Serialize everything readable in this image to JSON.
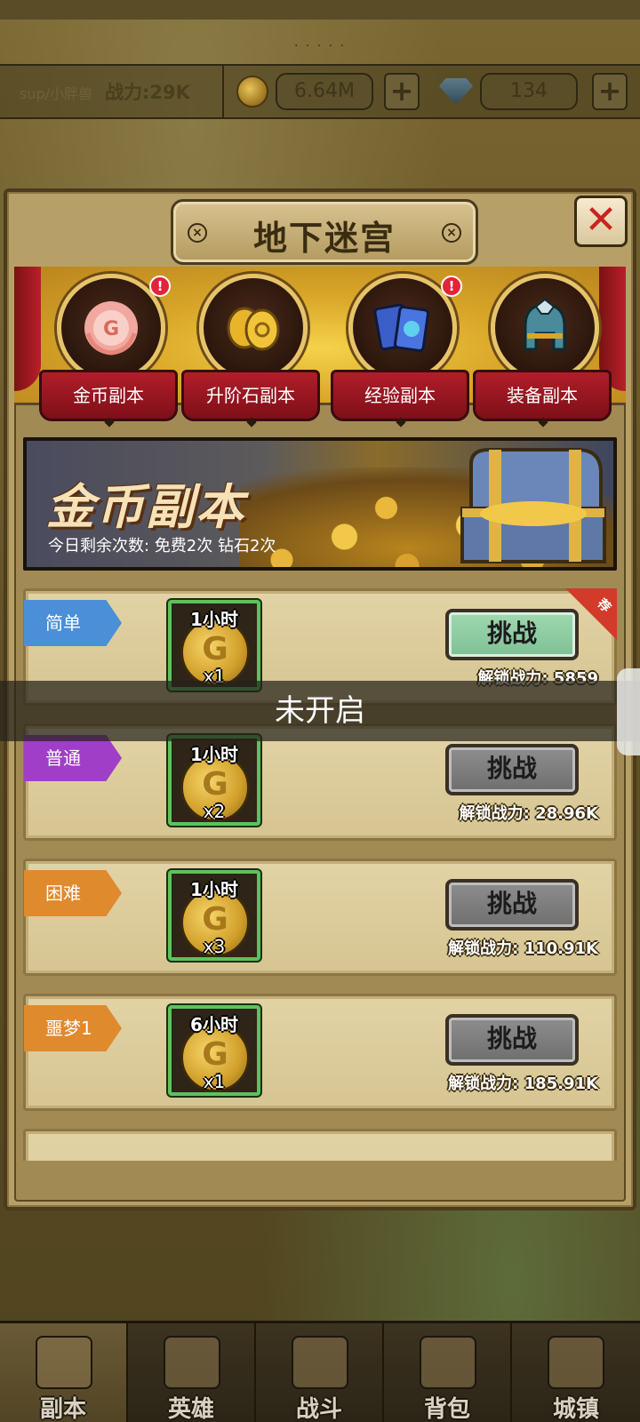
{
  "resource_bar": {
    "player_name": "sup/小胖兽",
    "power_text": "战力:29K",
    "gold_amount": "6.64M",
    "gem_amount": "134",
    "plus_label": "+"
  },
  "top_dots": ". . . . .",
  "dialog": {
    "title": "地下迷宫",
    "close_label": "✕",
    "screw_glyph": "×"
  },
  "categories": [
    {
      "label": "金币副本",
      "icon": "gold-laurel-emblem-icon",
      "alert": "!"
    },
    {
      "label": "升阶石副本",
      "icon": "upgrade-stone-icon",
      "alert": ""
    },
    {
      "label": "经验副本",
      "icon": "experience-cards-icon",
      "alert": "!"
    },
    {
      "label": "装备副本",
      "icon": "equipment-helmet-icon",
      "alert": ""
    }
  ],
  "banner": {
    "title": "金币副本",
    "subtitle": "今日剩余次数:  免费2次  钻石2次"
  },
  "stages": [
    {
      "tag": "简单",
      "tag_color": "#4a8fd8",
      "time": "1小时",
      "qty": "x1",
      "button": "挑战",
      "unlock": "解锁战力:  5859",
      "recommended": "荐"
    },
    {
      "tag": "普通",
      "tag_color": "#a03ec8",
      "time": "1小时",
      "qty": "x2",
      "button": "挑战",
      "unlock": "解锁战力:  28.96K",
      "recommended": ""
    },
    {
      "tag": "困难",
      "tag_color": "#e08a2e",
      "time": "1小时",
      "qty": "x3",
      "button": "挑战",
      "unlock": "解锁战力:  110.91K",
      "recommended": ""
    },
    {
      "tag": "噩梦1",
      "tag_color": "#e08a2e",
      "time": "6小时",
      "qty": "x1",
      "button": "挑战",
      "unlock": "解锁战力:  185.91K",
      "recommended": ""
    }
  ],
  "toast": "未开启",
  "bottom_nav": [
    {
      "label": "副本",
      "icon": "dungeon-map-icon",
      "active": true
    },
    {
      "label": "英雄",
      "icon": "hero-helmet-icon",
      "active": false
    },
    {
      "label": "战斗",
      "icon": "crossed-swords-icon",
      "active": false
    },
    {
      "label": "背包",
      "icon": "backpack-icon",
      "active": false
    },
    {
      "label": "城镇",
      "icon": "town-shop-icon",
      "active": false
    }
  ],
  "colors": {
    "accent_red": "#b01e2a",
    "challenge_active": "#8fcca2",
    "challenge_disabled": "#7e7e7e",
    "reward_border": "#5cc35a"
  }
}
